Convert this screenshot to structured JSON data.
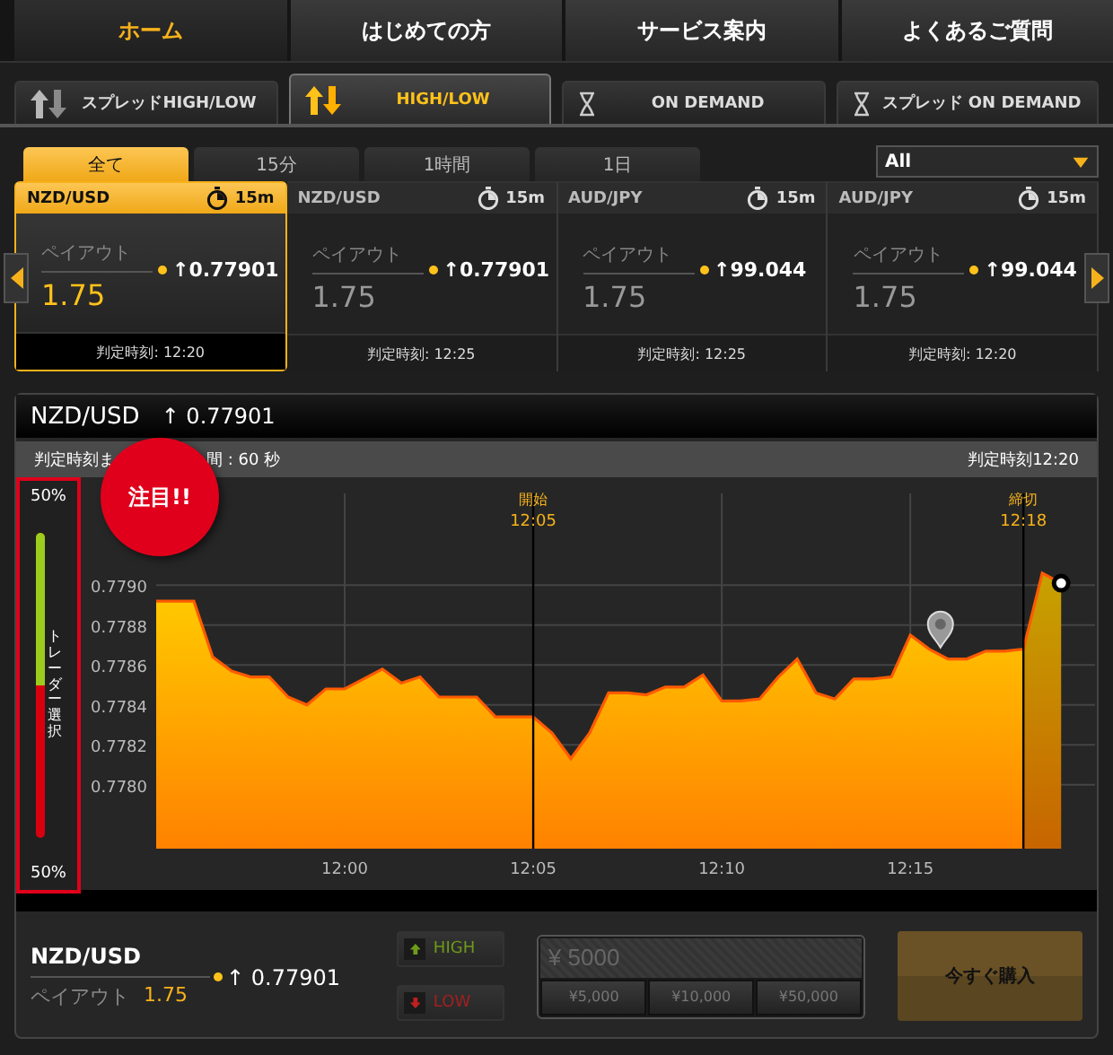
{
  "nav_tabs": [
    {
      "label": "ホーム",
      "selected": true
    },
    {
      "label": "はじめての方",
      "selected": false
    },
    {
      "label": "サービス案内",
      "selected": false
    },
    {
      "label": "よくあるご質問",
      "selected": false
    }
  ],
  "product_tabs": [
    {
      "label": "スプレッドHIGH/LOW",
      "kind": "arrows",
      "selected": false
    },
    {
      "label": "HIGH/LOW",
      "kind": "arrows",
      "selected": true
    },
    {
      "label": "ON DEMAND",
      "kind": "hourglass",
      "selected": false
    },
    {
      "label": "スプレッド ON DEMAND",
      "kind": "hourglass",
      "selected": false
    }
  ],
  "period_tabs": [
    {
      "label": "全て",
      "selected": true
    },
    {
      "label": "15分",
      "selected": false
    },
    {
      "label": "1時間",
      "selected": false
    },
    {
      "label": "1日",
      "selected": false
    }
  ],
  "filter_select": {
    "value": "All"
  },
  "cards": [
    {
      "pair": "NZD/USD",
      "duration": "15m",
      "payout_label": "ペイアウト",
      "payout": "1.75",
      "rate": "↑0.77901",
      "expiry": "判定時刻: 12:20",
      "selected": true
    },
    {
      "pair": "NZD/USD",
      "duration": "15m",
      "payout_label": "ペイアウト",
      "payout": "1.75",
      "rate": "↑0.77901",
      "expiry": "判定時刻: 12:25",
      "selected": false
    },
    {
      "pair": "AUD/JPY",
      "duration": "15m",
      "payout_label": "ペイアウト",
      "payout": "1.75",
      "rate": "↑99.044",
      "expiry": "判定時刻: 12:25",
      "selected": false
    },
    {
      "pair": "AUD/JPY",
      "duration": "15m",
      "payout_label": "ペイアウト",
      "payout": "1.75",
      "rate": "↑99.044",
      "expiry": "判定時刻: 12:20",
      "selected": false
    }
  ],
  "chart_panel": {
    "pair": "NZD/USD",
    "rate": "↑ 0.77901",
    "info_parts": [
      "判定時刻ま",
      "間 : 60 秒"
    ],
    "expiry": "判定時刻12:20",
    "trader_choice": {
      "label": "トレーダー選択",
      "high_percent": "50%",
      "low_percent": "50%",
      "level": 0.5
    },
    "callout": "注目!!",
    "chart_data": {
      "type": "area",
      "grid": true,
      "ylim": [
        0.77768,
        0.77946
      ],
      "categories": [
        null,
        null,
        null,
        null,
        null,
        null,
        null,
        null,
        null,
        null,
        "12:00",
        null,
        null,
        null,
        null,
        null,
        null,
        null,
        null,
        null,
        "12:05",
        null,
        null,
        null,
        null,
        null,
        null,
        null,
        null,
        null,
        "12:10",
        null,
        null,
        null,
        null,
        null,
        null,
        null,
        null,
        null,
        "12:15",
        null,
        null,
        null,
        null,
        null,
        null,
        null,
        null
      ],
      "yticks": [
        {
          "value": 0.778,
          "label": "0.7780"
        },
        {
          "value": 0.7782,
          "label": "0.7782"
        },
        {
          "value": 0.7784,
          "label": "0.7784"
        },
        {
          "value": 0.7786,
          "label": "0.7786"
        },
        {
          "value": 0.7788,
          "label": "0.7788"
        },
        {
          "value": 0.779,
          "label": "0.7790"
        }
      ],
      "series": [
        {
          "color": "#ff5a00",
          "values": [
            0.77892,
            0.77892,
            0.77892,
            0.77864,
            0.77857,
            0.77854,
            0.77854,
            0.77844,
            0.7784,
            0.77848,
            0.77848,
            0.77853,
            0.77858,
            0.77851,
            0.77854,
            0.77844,
            0.77844,
            0.77844,
            0.77834,
            0.77834,
            0.77834,
            0.77826,
            0.77813,
            0.77826,
            0.77846,
            0.77846,
            0.77845,
            0.77849,
            0.77849,
            0.77855,
            0.77842,
            0.77842,
            0.77843,
            0.77854,
            0.77863,
            0.77846,
            0.77843,
            0.77853,
            0.77853,
            0.77854,
            0.77875,
            0.77868,
            0.77863,
            0.77863,
            0.77867,
            0.77867,
            0.77868,
            0.77906,
            0.77901
          ]
        }
      ],
      "annotations": [
        "開始",
        "12:05",
        "締切",
        "12:18"
      ]
    }
  },
  "order": {
    "pair": "NZD/USD",
    "rate": "↑ 0.77901",
    "payout_label": "ペイアウト",
    "payout": "1.75",
    "high_button": "HIGH",
    "low_button": "LOW",
    "amount_placeholder": "¥ 5000",
    "presets": [
      "¥5,000",
      "¥10,000",
      "¥50,000"
    ],
    "buy_button": "今すぐ購入"
  }
}
